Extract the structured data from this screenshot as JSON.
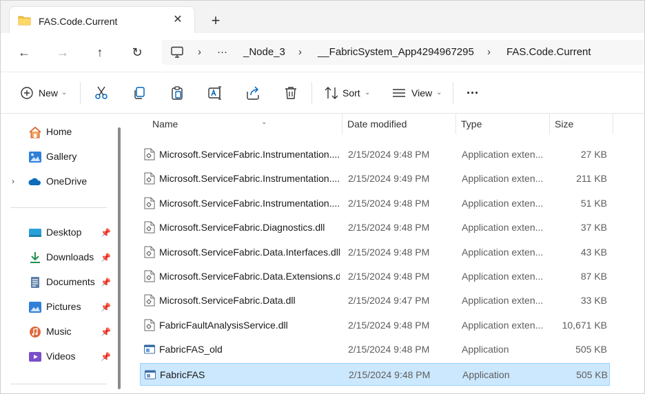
{
  "tab": {
    "title": "FAS.Code.Current",
    "close": "✕",
    "new_tab": "+"
  },
  "nav": {
    "back": "←",
    "forward": "→",
    "up": "↑",
    "refresh": "↻"
  },
  "address": {
    "overflow": "···",
    "crumbs": [
      "_Node_3",
      "__FabricSystem_App4294967295",
      "FAS.Code.Current"
    ]
  },
  "commands": {
    "new": "New",
    "sort": "Sort",
    "view": "View",
    "more": "···"
  },
  "sidebar": {
    "top": [
      {
        "label": "Home"
      },
      {
        "label": "Gallery"
      },
      {
        "label": "OneDrive"
      }
    ],
    "pinned": [
      {
        "label": "Desktop"
      },
      {
        "label": "Downloads"
      },
      {
        "label": "Documents"
      },
      {
        "label": "Pictures"
      },
      {
        "label": "Music"
      },
      {
        "label": "Videos"
      }
    ]
  },
  "columns": {
    "name": "Name",
    "date": "Date modified",
    "type": "Type",
    "size": "Size"
  },
  "files": [
    {
      "name": "Microsoft.ServiceFabric.Instrumentation....",
      "date": "2/15/2024 9:48 PM",
      "type": "Application exten...",
      "size": "27 KB",
      "icon": "dll"
    },
    {
      "name": "Microsoft.ServiceFabric.Instrumentation....",
      "date": "2/15/2024 9:49 PM",
      "type": "Application exten...",
      "size": "211 KB",
      "icon": "dll"
    },
    {
      "name": "Microsoft.ServiceFabric.Instrumentation....",
      "date": "2/15/2024 9:48 PM",
      "type": "Application exten...",
      "size": "51 KB",
      "icon": "dll"
    },
    {
      "name": "Microsoft.ServiceFabric.Diagnostics.dll",
      "date": "2/15/2024 9:48 PM",
      "type": "Application exten...",
      "size": "37 KB",
      "icon": "dll"
    },
    {
      "name": "Microsoft.ServiceFabric.Data.Interfaces.dll",
      "date": "2/15/2024 9:48 PM",
      "type": "Application exten...",
      "size": "43 KB",
      "icon": "dll"
    },
    {
      "name": "Microsoft.ServiceFabric.Data.Extensions.dll",
      "date": "2/15/2024 9:48 PM",
      "type": "Application exten...",
      "size": "87 KB",
      "icon": "dll"
    },
    {
      "name": "Microsoft.ServiceFabric.Data.dll",
      "date": "2/15/2024 9:47 PM",
      "type": "Application exten...",
      "size": "33 KB",
      "icon": "dll"
    },
    {
      "name": "FabricFaultAnalysisService.dll",
      "date": "2/15/2024 9:48 PM",
      "type": "Application exten...",
      "size": "10,671 KB",
      "icon": "dll"
    },
    {
      "name": "FabricFAS_old",
      "date": "2/15/2024 9:48 PM",
      "type": "Application",
      "size": "505 KB",
      "icon": "exe"
    },
    {
      "name": "FabricFAS",
      "date": "2/15/2024 9:48 PM",
      "type": "Application",
      "size": "505 KB",
      "icon": "exe",
      "selected": true
    }
  ],
  "colors": {
    "accent": "#0067c0",
    "selection": "#cce8ff",
    "folder": "#f8c53a"
  }
}
